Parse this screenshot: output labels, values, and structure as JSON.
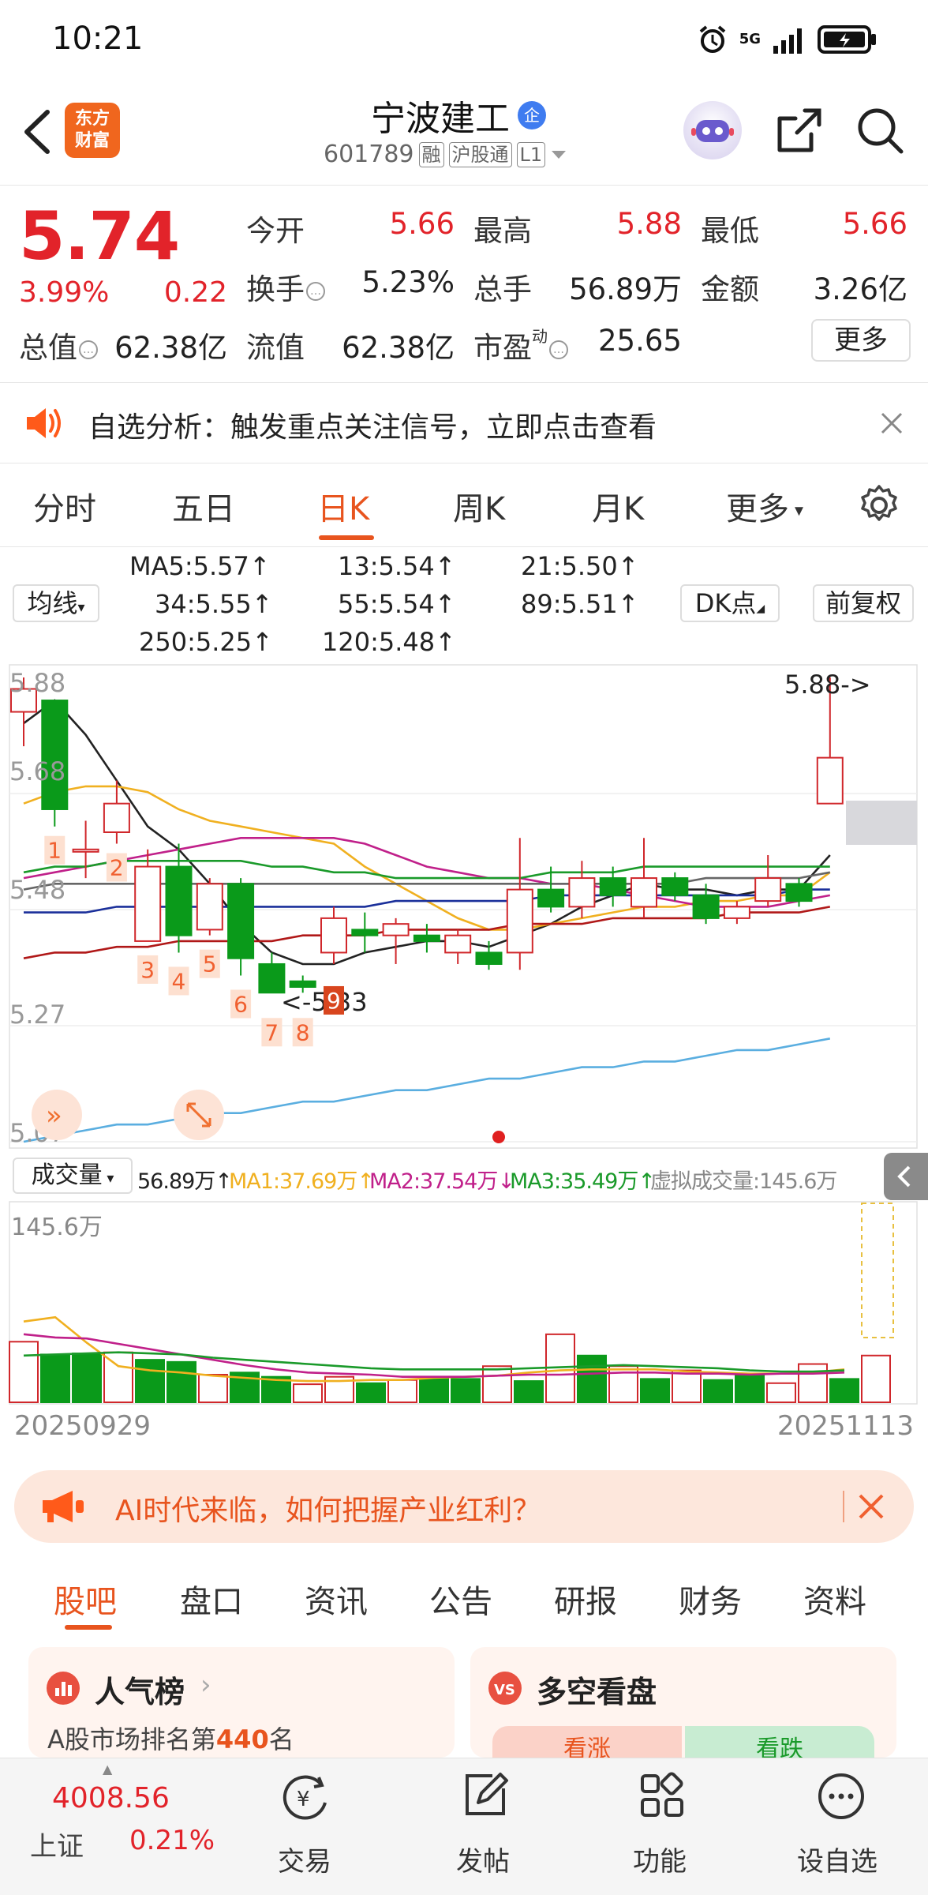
{
  "status_bar": {
    "time": "10:21",
    "network": "5G"
  },
  "header": {
    "logo": "东方财富",
    "stock_name": "宁波建工",
    "badge": "企",
    "stock_code": "601789",
    "tags": [
      "融",
      "沪股通",
      "L1"
    ]
  },
  "quote": {
    "price": "5.74",
    "change_pct": "3.99%",
    "change": "0.22",
    "stats": [
      {
        "label": "今开",
        "value": "5.66"
      },
      {
        "label": "最高",
        "value": "5.88"
      },
      {
        "label": "最低",
        "value": "5.66"
      },
      {
        "label": "换手",
        "value": "5.23%"
      },
      {
        "label": "总手",
        "value": "56.89万"
      },
      {
        "label": "金额",
        "value": "3.26亿"
      },
      {
        "label": "总值",
        "value": "62.38亿"
      },
      {
        "label": "流值",
        "value": "62.38亿"
      },
      {
        "label": "市盈",
        "sup": "动",
        "value": "25.65"
      }
    ],
    "more_label": "更多"
  },
  "notice": {
    "text": "自选分析：触发重点关注信号，立即点击查看"
  },
  "period_tabs": [
    "分时",
    "五日",
    "日K",
    "周K",
    "月K",
    "更多"
  ],
  "ma_legend": {
    "selector": "均线",
    "items": [
      {
        "text": "MA5:5.57↑",
        "color": "#222222"
      },
      {
        "text": "13:5.54↑",
        "color": "#f0b020"
      },
      {
        "text": "21:5.50↑",
        "color": "#c0208a"
      },
      {
        "text": "34:5.55↑",
        "color": "#1a9a2a"
      },
      {
        "text": "55:5.54↑",
        "color": "#666666"
      },
      {
        "text": "89:5.51↑",
        "color": "#1a2f9a"
      },
      {
        "text": "250:5.25↑",
        "color": "#5aaee0"
      },
      {
        "text": "120:5.48↑",
        "color": "#b01818"
      }
    ],
    "dk_label": "DK点",
    "adjust_label": "前复权"
  },
  "kline": {
    "y_labels": [
      "5.88",
      "5.68",
      "5.48",
      "5.27",
      "5.07"
    ],
    "max_label": "5.88->",
    "min_label": "<-5.33",
    "seq_numbers": [
      "1",
      "2",
      "3",
      "4",
      "5",
      "6",
      "7",
      "8",
      "9"
    ],
    "start_date": "20250929",
    "end_date": "20251113"
  },
  "volume": {
    "selector": "成交量",
    "value": "56.89万↑",
    "ma1": "MA1:37.69万↑",
    "ma2": "MA2:37.54万↓",
    "ma3": "MA3:35.49万↑",
    "virtual": "虚拟成交量:145.6万",
    "max_label": "145.6万"
  },
  "chart_data": {
    "type": "candlestick",
    "ylim": [
      5.07,
      5.88
    ],
    "candles": [
      {
        "o": 5.82,
        "c": 5.86,
        "h": 5.88,
        "l": 5.76
      },
      {
        "o": 5.84,
        "c": 5.65,
        "h": 5.84,
        "l": 5.62
      },
      {
        "o": 5.58,
        "c": 5.58,
        "h": 5.63,
        "l": 5.53
      },
      {
        "o": 5.61,
        "c": 5.66,
        "h": 5.7,
        "l": 5.59
      },
      {
        "o": 5.42,
        "c": 5.55,
        "h": 5.58,
        "l": 5.42
      },
      {
        "o": 5.55,
        "c": 5.43,
        "h": 5.59,
        "l": 5.4
      },
      {
        "o": 5.44,
        "c": 5.52,
        "h": 5.53,
        "l": 5.43
      },
      {
        "o": 5.52,
        "c": 5.39,
        "h": 5.53,
        "l": 5.36
      },
      {
        "o": 5.38,
        "c": 5.33,
        "h": 5.4,
        "l": 5.33
      },
      {
        "o": 5.35,
        "c": 5.34,
        "h": 5.36,
        "l": 5.33
      },
      {
        "o": 5.4,
        "c": 5.46,
        "h": 5.48,
        "l": 5.38
      },
      {
        "o": 5.44,
        "c": 5.43,
        "h": 5.47,
        "l": 5.4
      },
      {
        "o": 5.43,
        "c": 5.45,
        "h": 5.46,
        "l": 5.38
      },
      {
        "o": 5.43,
        "c": 5.42,
        "h": 5.45,
        "l": 5.4
      },
      {
        "o": 5.4,
        "c": 5.43,
        "h": 5.44,
        "l": 5.38
      },
      {
        "o": 5.4,
        "c": 5.38,
        "h": 5.42,
        "l": 5.37
      },
      {
        "o": 5.4,
        "c": 5.51,
        "h": 5.6,
        "l": 5.37
      },
      {
        "o": 5.51,
        "c": 5.48,
        "h": 5.55,
        "l": 5.47
      },
      {
        "o": 5.48,
        "c": 5.53,
        "h": 5.56,
        "l": 5.46
      },
      {
        "o": 5.53,
        "c": 5.5,
        "h": 5.55,
        "l": 5.48
      },
      {
        "o": 5.48,
        "c": 5.53,
        "h": 5.6,
        "l": 5.46
      },
      {
        "o": 5.53,
        "c": 5.5,
        "h": 5.54,
        "l": 5.49
      },
      {
        "o": 5.5,
        "c": 5.46,
        "h": 5.52,
        "l": 5.45
      },
      {
        "o": 5.46,
        "c": 5.48,
        "h": 5.49,
        "l": 5.45
      },
      {
        "o": 5.49,
        "c": 5.53,
        "h": 5.57,
        "l": 5.48
      },
      {
        "o": 5.52,
        "c": 5.49,
        "h": 5.53,
        "l": 5.48
      },
      {
        "o": 5.66,
        "c": 5.74,
        "h": 5.88,
        "l": 5.66
      }
    ],
    "ma_lines": [
      {
        "name": "MA5",
        "color": "#222222",
        "values": [
          5.8,
          5.84,
          5.78,
          5.7,
          5.62,
          5.58,
          5.52,
          5.45,
          5.4,
          5.38,
          5.38,
          5.4,
          5.41,
          5.42,
          5.42,
          5.41,
          5.43,
          5.45,
          5.48,
          5.5,
          5.52,
          5.51,
          5.51,
          5.5,
          5.51,
          5.51,
          5.57
        ]
      },
      {
        "name": "MA13",
        "color": "#f0b020",
        "values": [
          5.66,
          5.68,
          5.69,
          5.69,
          5.68,
          5.65,
          5.63,
          5.62,
          5.61,
          5.6,
          5.59,
          5.55,
          5.52,
          5.49,
          5.46,
          5.44,
          5.44,
          5.45,
          5.46,
          5.47,
          5.48,
          5.48,
          5.49,
          5.49,
          5.5,
          5.5,
          5.54
        ]
      },
      {
        "name": "MA21",
        "color": "#c0208a",
        "values": [
          5.53,
          5.54,
          5.55,
          5.56,
          5.57,
          5.58,
          5.59,
          5.6,
          5.6,
          5.6,
          5.6,
          5.59,
          5.57,
          5.55,
          5.54,
          5.53,
          5.53,
          5.52,
          5.52,
          5.51,
          5.5,
          5.49,
          5.48,
          5.48,
          5.48,
          5.49,
          5.5
        ]
      },
      {
        "name": "MA34",
        "color": "#1a9a2a",
        "values": [
          5.54,
          5.55,
          5.55,
          5.56,
          5.56,
          5.56,
          5.56,
          5.56,
          5.55,
          5.55,
          5.54,
          5.54,
          5.53,
          5.53,
          5.53,
          5.53,
          5.53,
          5.54,
          5.54,
          5.54,
          5.55,
          5.55,
          5.55,
          5.55,
          5.55,
          5.55,
          5.55
        ]
      },
      {
        "name": "MA55",
        "color": "#666666",
        "values": [
          5.51,
          5.52,
          5.52,
          5.52,
          5.52,
          5.52,
          5.52,
          5.52,
          5.52,
          5.52,
          5.52,
          5.52,
          5.52,
          5.52,
          5.52,
          5.52,
          5.52,
          5.52,
          5.52,
          5.52,
          5.52,
          5.52,
          5.53,
          5.53,
          5.53,
          5.53,
          5.54
        ]
      },
      {
        "name": "MA89",
        "color": "#1a2f9a",
        "values": [
          5.47,
          5.47,
          5.47,
          5.48,
          5.48,
          5.48,
          5.48,
          5.48,
          5.48,
          5.48,
          5.48,
          5.48,
          5.49,
          5.49,
          5.49,
          5.49,
          5.49,
          5.5,
          5.5,
          5.5,
          5.5,
          5.5,
          5.5,
          5.5,
          5.5,
          5.51,
          5.51
        ]
      },
      {
        "name": "MA120",
        "color": "#b01818",
        "values": [
          5.39,
          5.4,
          5.4,
          5.41,
          5.41,
          5.42,
          5.42,
          5.42,
          5.42,
          5.43,
          5.43,
          5.43,
          5.44,
          5.44,
          5.44,
          5.44,
          5.45,
          5.45,
          5.45,
          5.46,
          5.46,
          5.46,
          5.46,
          5.47,
          5.47,
          5.47,
          5.48
        ]
      },
      {
        "name": "MA250",
        "color": "#5aaee0",
        "values": [
          5.07,
          5.08,
          5.09,
          5.1,
          5.1,
          5.11,
          5.12,
          5.12,
          5.13,
          5.14,
          5.14,
          5.15,
          5.16,
          5.16,
          5.17,
          5.18,
          5.18,
          5.19,
          5.2,
          5.2,
          5.21,
          5.21,
          5.22,
          5.23,
          5.23,
          5.24,
          5.25
        ]
      }
    ],
    "volume_max": 145.6,
    "volumes": [
      57,
      45,
      46,
      47,
      40,
      38,
      26,
      28,
      24,
      17,
      24,
      18,
      21,
      22,
      22,
      34,
      20,
      64,
      44,
      34,
      22,
      30,
      21,
      25,
      18,
      36,
      22,
      44
    ],
    "volume_up": [
      true,
      false,
      false,
      true,
      false,
      false,
      true,
      false,
      false,
      true,
      true,
      false,
      true,
      false,
      false,
      true,
      false,
      true,
      false,
      true,
      false,
      true,
      false,
      false,
      true,
      true,
      false,
      true
    ],
    "vol_ma_lines": [
      {
        "name": "MA1",
        "color": "#f0b020",
        "values": [
          76,
          80,
          56,
          34,
          30,
          28,
          25,
          23,
          21,
          20,
          20,
          21,
          21,
          23,
          24,
          25,
          28,
          30,
          31,
          31,
          31,
          29,
          28,
          27,
          27,
          28,
          31
        ]
      },
      {
        "name": "MA2",
        "color": "#c0208a",
        "values": [
          64,
          61,
          60,
          55,
          50,
          45,
          40,
          35,
          31,
          28,
          27,
          26,
          24,
          24,
          24,
          25,
          26,
          26,
          27,
          28,
          28,
          27,
          27,
          26,
          27,
          27,
          28
        ]
      },
      {
        "name": "MA3",
        "color": "#1a9a2a",
        "values": [
          44,
          45,
          46,
          47,
          46,
          45,
          42,
          40,
          38,
          36,
          34,
          32,
          31,
          31,
          31,
          31,
          32,
          33,
          34,
          35,
          34,
          33,
          32,
          30,
          29,
          29,
          30
        ]
      }
    ]
  },
  "ad": {
    "text": "AI时代来临，如何把握产业红利？"
  },
  "bottom_tabs": [
    "股吧",
    "盘口",
    "资讯",
    "公告",
    "研报",
    "财务",
    "资料"
  ],
  "cards": [
    {
      "title": "人气榜",
      "sub_prefix": "A股市场排名第",
      "sub_num": "440",
      "sub_suffix": "名"
    },
    {
      "title": "多空看盘",
      "left": "看涨",
      "right": "看跌"
    }
  ],
  "nav": {
    "index_value": "4008.56",
    "index_name": "上证",
    "index_change": "0.21%",
    "items": [
      "交易",
      "发帖",
      "功能",
      "设自选"
    ]
  }
}
